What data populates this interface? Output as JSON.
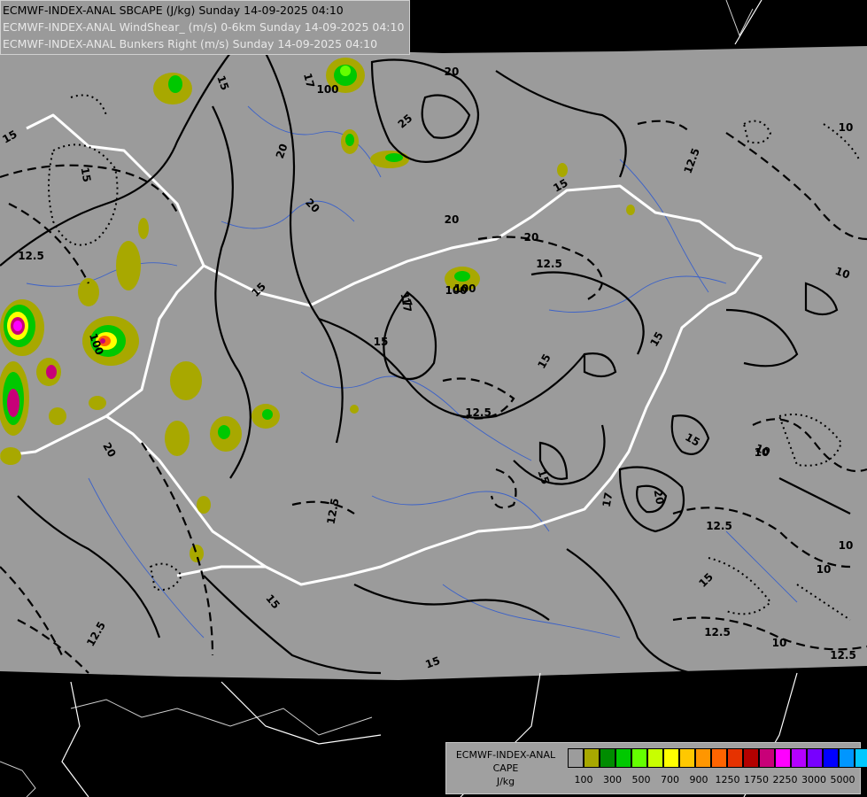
{
  "header": {
    "line1": "ECMWF-INDEX-ANAL SBCAPE (J/kg) Sunday 14-09-2025 04:10",
    "line2": "ECMWF-INDEX-ANAL WindShear_ (m/s) 0-6km Sunday 14-09-2025 04:10",
    "line3": "ECMWF-INDEX-ANAL Bunkers Right (m/s) Sunday 14-09-2025 04:10"
  },
  "legend": {
    "title1": "ECMWF-INDEX-ANAL",
    "title2": "CAPE",
    "unit": "J/kg",
    "colors": [
      "#9c9c9c",
      "#a8a800",
      "#008c00",
      "#00c800",
      "#64ff00",
      "#c8ff00",
      "#ffff00",
      "#ffc800",
      "#ff9600",
      "#ff6400",
      "#e63200",
      "#b40000",
      "#c80078",
      "#ff00ff",
      "#b400ff",
      "#7800ff",
      "#0000ff",
      "#0096ff",
      "#00c8ff",
      "#64ffff",
      "#ffffff"
    ],
    "labels": [
      "100",
      "300",
      "500",
      "700",
      "900",
      "1250",
      "1750",
      "2250",
      "3000",
      "5000"
    ]
  },
  "contour_labels": [
    "15",
    "17",
    "20",
    "25",
    "20",
    "17",
    "20",
    "15",
    "15",
    "12.5",
    "12.5",
    "20",
    "17",
    "15",
    "15",
    "12.5",
    "15",
    "100",
    "100",
    "20",
    "15",
    "12.5",
    "10",
    "10",
    "15",
    "12.5",
    "15",
    "17",
    "20",
    "15",
    "12.5",
    "10",
    "12.5",
    "10",
    "12.5",
    "15",
    "12.5",
    "15",
    "10",
    "10",
    "15",
    "20",
    "10",
    "100",
    "100"
  ]
}
